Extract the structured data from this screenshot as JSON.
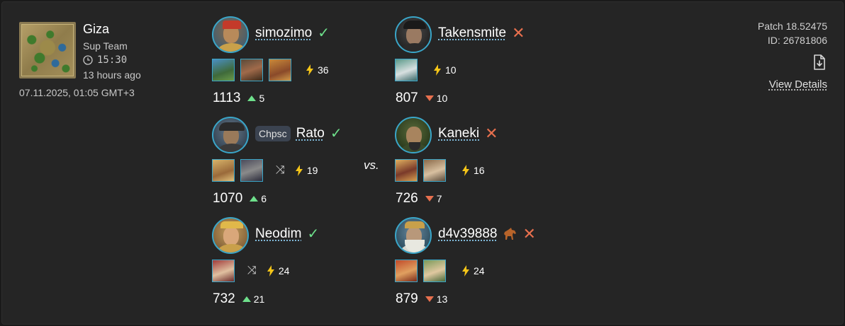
{
  "match": {
    "map_name": "Giza",
    "mode": "Sup Team",
    "duration": "15:30",
    "ago": "13 hours ago",
    "date": "07.11.2025, 01:05 GMT+3",
    "patch": "Patch 18.52475",
    "id": "ID: 26781806",
    "view_details": "View Details",
    "vs": "vs."
  },
  "team1": [
    {
      "name": "simozimo",
      "tag": "",
      "result": "win",
      "civs": 3,
      "random": false,
      "apm": "36",
      "rating": "1113",
      "delta": "5",
      "delta_dir": "up"
    },
    {
      "name": "Rato",
      "tag": "Chpsc",
      "result": "win",
      "civs": 2,
      "random": true,
      "apm": "19",
      "rating": "1070",
      "delta": "6",
      "delta_dir": "up"
    },
    {
      "name": "Neodim",
      "tag": "",
      "result": "win",
      "civs": 1,
      "random": true,
      "apm": "24",
      "rating": "732",
      "delta": "21",
      "delta_dir": "up"
    }
  ],
  "team2": [
    {
      "name": "Takensmite",
      "tag": "",
      "result": "loss",
      "civs": 1,
      "random": false,
      "apm": "10",
      "rating": "807",
      "delta": "10",
      "delta_dir": "down"
    },
    {
      "name": "Kaneki",
      "tag": "",
      "result": "loss",
      "civs": 2,
      "random": false,
      "apm": "16",
      "rating": "726",
      "delta": "7",
      "delta_dir": "down"
    },
    {
      "name": "d4v39888",
      "tag": "",
      "result": "loss",
      "civs": 2,
      "random": false,
      "apm": "24",
      "rating": "879",
      "delta": "13",
      "delta_dir": "down",
      "badge": "horse-icon"
    }
  ],
  "colors": {
    "win": "#6ee08b",
    "loss": "#e8704e",
    "accent_border": "#3aa6c9",
    "bolt": "#f5c518"
  }
}
